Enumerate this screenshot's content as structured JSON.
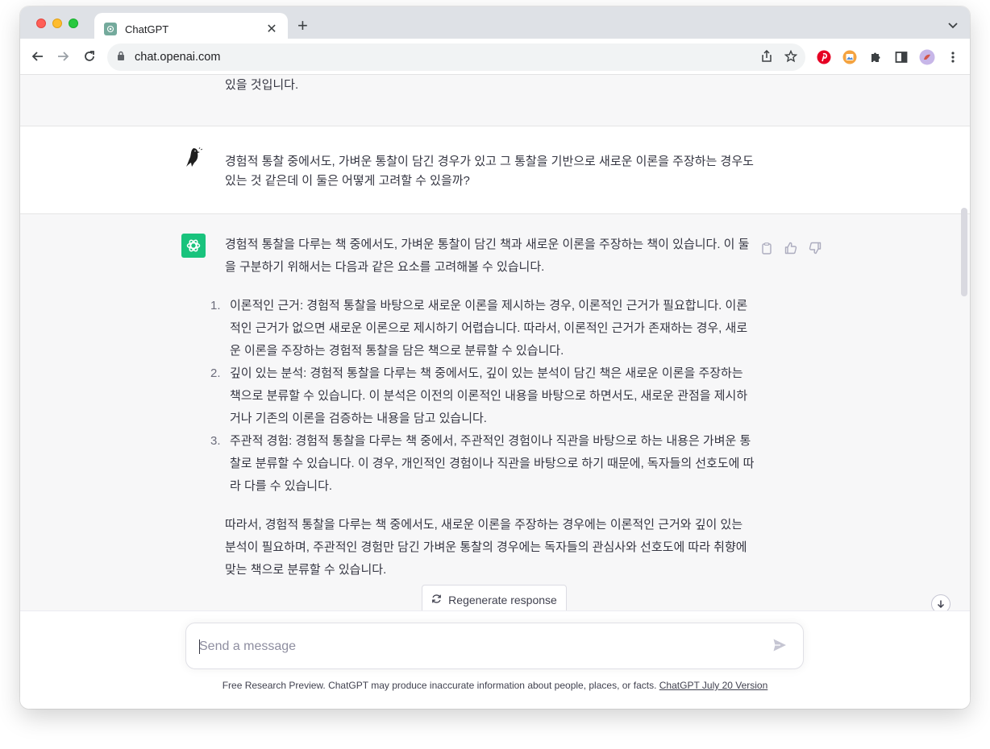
{
  "browser": {
    "tab_title": "ChatGPT",
    "url": "chat.openai.com",
    "new_tab_symbol": "+",
    "close_symbol": "✕"
  },
  "conversation": {
    "prev_tail": "있을 것입니다.",
    "user_message": "경험적 통찰 중에서도, 가벼운 통찰이 담긴 경우가 있고 그 통찰을 기반으로 새로운 이론을 주장하는 경우도 있는 것 같은데 이 둘은 어떻게 고려할 수 있을까?",
    "ai_intro": "경험적 통찰을 다루는 책 중에서도, 가벼운 통찰이 담긴 책과 새로운 이론을 주장하는 책이 있습니다. 이 둘을 구분하기 위해서는 다음과 같은 요소를 고려해볼 수 있습니다.",
    "ai_points": [
      {
        "num": "1.",
        "text": "이론적인 근거: 경험적 통찰을 바탕으로 새로운 이론을 제시하는 경우, 이론적인 근거가 필요합니다. 이론적인 근거가 없으면 새로운 이론으로 제시하기 어렵습니다. 따라서, 이론적인 근거가 존재하는 경우, 새로운 이론을 주장하는 경험적 통찰을 담은 책으로 분류할 수 있습니다."
      },
      {
        "num": "2.",
        "text": "깊이 있는 분석: 경험적 통찰을 다루는 책 중에서도, 깊이 있는 분석이 담긴 책은 새로운 이론을 주장하는 책으로 분류할 수 있습니다. 이 분석은 이전의 이론적인 내용을 바탕으로 하면서도, 새로운 관점을 제시하거나 기존의 이론을 검증하는 내용을 담고 있습니다."
      },
      {
        "num": "3.",
        "text": "주관적 경험: 경험적 통찰을 다루는 책 중에서, 주관적인 경험이나 직관을 바탕으로 하는 내용은 가벼운 통찰로 분류할 수 있습니다. 이 경우, 개인적인 경험이나 직관을 바탕으로 하기 때문에, 독자들의 선호도에 따라 다를 수 있습니다."
      }
    ],
    "ai_conclusion": "따라서, 경험적 통찰을 다루는 책 중에서도, 새로운 이론을 주장하는 경우에는 이론적인 근거와 깊이 있는 분석이 필요하며, 주관적인 경험만 담긴 가벼운 통찰의 경우에는 독자들의 관심사와 선호도에 따라 취향에 맞는 책으로 분류할 수 있습니다."
  },
  "regenerate_label": "Regenerate response",
  "composer": {
    "placeholder": "Send a message"
  },
  "footer": {
    "disclaimer": "Free Research Preview. ChatGPT may produce inaccurate information about people, places, or facts.",
    "version_link": "ChatGPT July 20 Version"
  },
  "colors": {
    "accent_green": "#19c37d",
    "pinterest_red": "#e60023"
  }
}
